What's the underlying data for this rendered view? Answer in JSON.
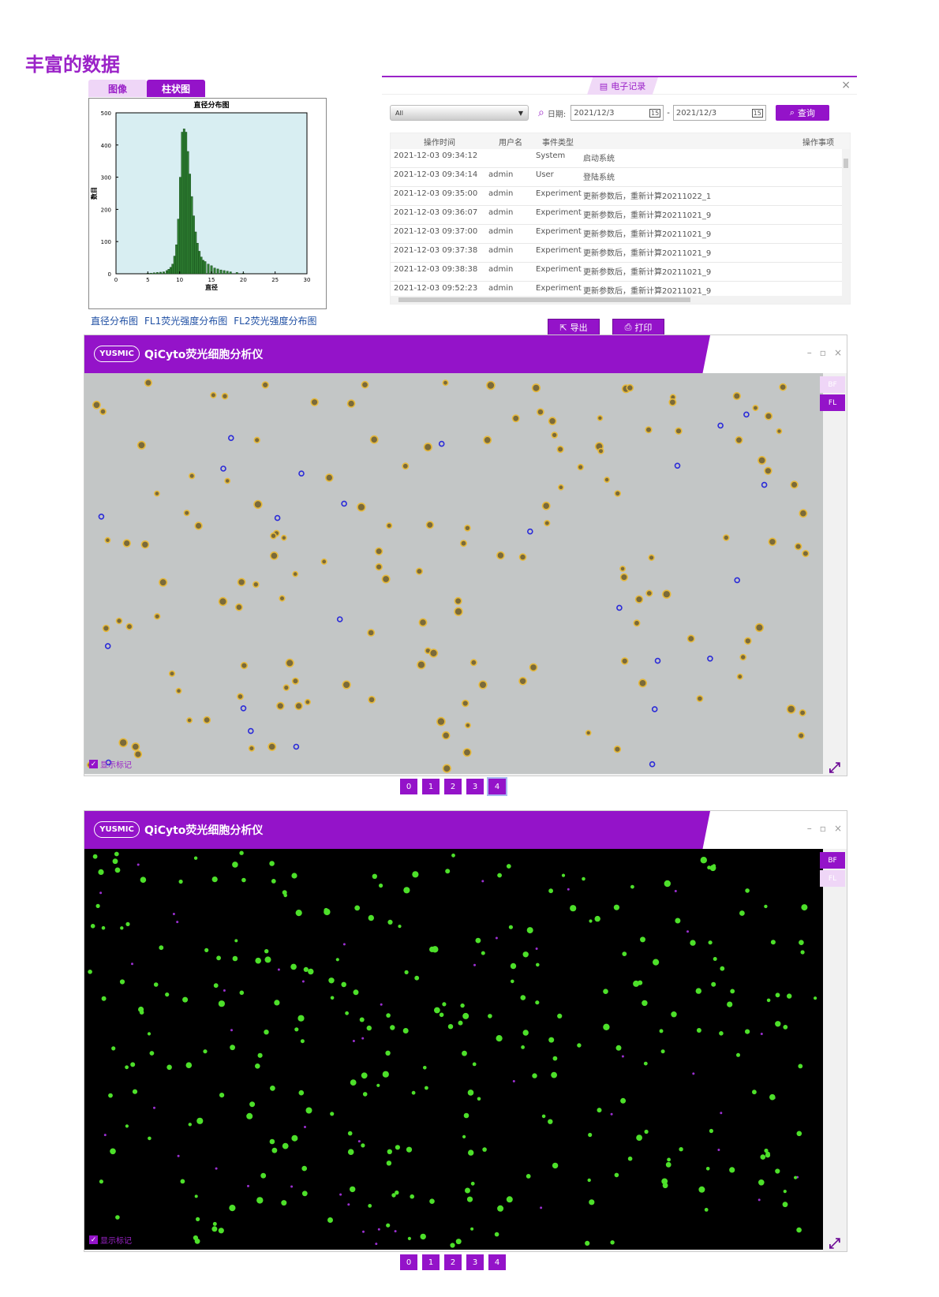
{
  "page_title": "丰富的数据",
  "histogram": {
    "tabs": [
      {
        "label": "图像",
        "active": false
      },
      {
        "label": "柱状图",
        "active": true
      }
    ],
    "links": [
      "直径分布图",
      "FL1荧光强度分布图",
      "FL2荧光强度分布图"
    ],
    "chart_data": {
      "type": "bar",
      "title": "直径分布图",
      "xlabel": "直径",
      "ylabel": "数目",
      "xlim": [
        0,
        30
      ],
      "ylim": [
        0,
        500
      ],
      "x_ticks": [
        "0",
        "5",
        "10",
        "15",
        "20",
        "25",
        "30"
      ],
      "y_ticks": [
        "0",
        "100",
        "200",
        "300",
        "400",
        "500"
      ],
      "x": [
        5.0,
        5.5,
        6.0,
        6.5,
        7.0,
        7.5,
        8.0,
        8.3,
        8.6,
        8.9,
        9.2,
        9.5,
        9.8,
        10.1,
        10.4,
        10.7,
        11.0,
        11.3,
        11.6,
        11.9,
        12.2,
        12.5,
        12.8,
        13.1,
        13.4,
        13.7,
        14.0,
        14.5,
        15.0,
        15.5,
        16.0,
        16.5,
        17.0,
        17.5,
        18.0,
        19.0,
        20.0
      ],
      "values": [
        2,
        2,
        3,
        4,
        5,
        6,
        10,
        14,
        20,
        30,
        55,
        90,
        170,
        300,
        440,
        450,
        440,
        380,
        310,
        240,
        180,
        130,
        95,
        70,
        52,
        42,
        38,
        30,
        25,
        18,
        15,
        12,
        10,
        8,
        6,
        4,
        2
      ],
      "grid": false,
      "bar_color": "#2e7d32",
      "plot_bg": "#d8eef2"
    }
  },
  "log": {
    "tab_title": "电子记录",
    "close": "×",
    "filter": {
      "select_value": "All",
      "date_label": "日期:",
      "date_from": "2021/12/3",
      "date_to": "2021/12/3",
      "separator": "-",
      "query_btn": "查询"
    },
    "columns": [
      "操作时间",
      "用户名",
      "事件类型",
      "操作事项"
    ],
    "rows": [
      [
        "2021-12-03 09:34:12",
        "",
        "System",
        "启动系统"
      ],
      [
        "2021-12-03 09:34:14",
        "admin",
        "User",
        "登陆系统"
      ],
      [
        "2021-12-03 09:35:00",
        "admin",
        "Experiment",
        "更新参数后，重新计算20211022_1"
      ],
      [
        "2021-12-03 09:36:07",
        "admin",
        "Experiment",
        "更新参数后，重新计算20211021_9"
      ],
      [
        "2021-12-03 09:37:00",
        "admin",
        "Experiment",
        "更新参数后，重新计算20211021_9"
      ],
      [
        "2021-12-03 09:37:38",
        "admin",
        "Experiment",
        "更新参数后，重新计算20211021_9"
      ],
      [
        "2021-12-03 09:38:38",
        "admin",
        "Experiment",
        "更新参数后，重新计算20211021_9"
      ],
      [
        "2021-12-03 09:52:23",
        "admin",
        "Experiment",
        "更新参数后，重新计算20211021_9"
      ]
    ],
    "export_btn": "导出",
    "print_btn": "打印"
  },
  "analyzer1": {
    "logo": "YUSMIC",
    "app_name": "QiCyto荧光细胞分析仪",
    "controls": [
      "–",
      "▫",
      "×"
    ],
    "side_buttons": [
      {
        "label": "BF",
        "on": false
      },
      {
        "label": "FL",
        "on": true
      }
    ],
    "show_marks": "显示标记",
    "pages": [
      "0",
      "1",
      "2",
      "3",
      "4"
    ],
    "current_page": "4",
    "bg": "#c3c6c6"
  },
  "analyzer2": {
    "logo": "YUSMIC",
    "app_name": "QiCyto荧光细胞分析仪",
    "controls": [
      "–",
      "▫",
      "×"
    ],
    "side_buttons": [
      {
        "label": "BF",
        "on": true
      },
      {
        "label": "FL",
        "on": false
      }
    ],
    "show_marks": "显示标记",
    "pages": [
      "0",
      "1",
      "2",
      "3",
      "4"
    ],
    "current_page": "",
    "bg": "#000000"
  }
}
